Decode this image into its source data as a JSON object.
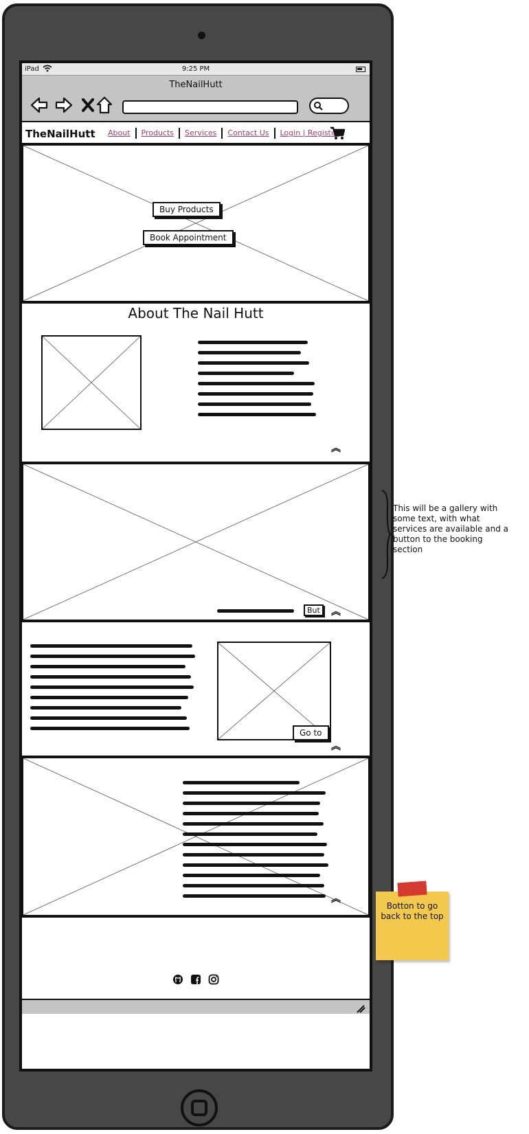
{
  "status_bar": {
    "carrier": "iPad",
    "time": "9:25 PM"
  },
  "browser": {
    "title": "TheNailHutt"
  },
  "nav": {
    "brand": "TheNailHutt",
    "links": [
      "About",
      "Products",
      "Services",
      "Contact Us",
      "Login | Register"
    ]
  },
  "hero": {
    "buy_button": "Buy Products",
    "book_button": "Book Appointment"
  },
  "about": {
    "heading": "About The Nail Hutt"
  },
  "gallery": {
    "button": "But"
  },
  "services": {
    "button": "Go to"
  },
  "annotation": {
    "text": "This will be a gallery with some text, with what services are available and a button to the booking section"
  },
  "sticky_note": {
    "text": "Botton to go back to the top"
  },
  "icons": [
    "back-arrow-icon",
    "forward-arrow-icon",
    "close-icon",
    "home-icon",
    "search-icon",
    "cart-icon",
    "chevron-up-icon",
    "github-icon",
    "facebook-icon",
    "instagram-icon"
  ]
}
